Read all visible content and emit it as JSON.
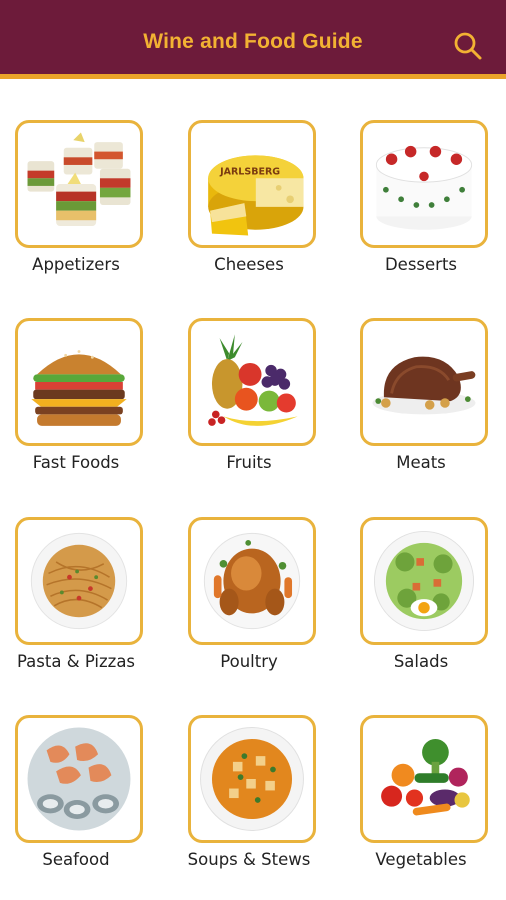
{
  "app": {
    "title": "Wine and Food Guide",
    "bar_color": "#6d1b3a",
    "accent_color": "#e9a42a",
    "search_icon": "search-icon"
  },
  "categories": [
    {
      "label": "Appetizers",
      "icon": "appetizers-image"
    },
    {
      "label": "Cheeses",
      "icon": "cheese-image"
    },
    {
      "label": "Desserts",
      "icon": "cake-image"
    },
    {
      "label": "Fast Foods",
      "icon": "burger-image"
    },
    {
      "label": "Fruits",
      "icon": "fruits-image"
    },
    {
      "label": "Meats",
      "icon": "roast-image"
    },
    {
      "label": "Pasta & Pizzas",
      "icon": "pasta-image"
    },
    {
      "label": "Poultry",
      "icon": "chicken-image"
    },
    {
      "label": "Salads",
      "icon": "salad-image"
    },
    {
      "label": "Seafood",
      "icon": "seafood-image"
    },
    {
      "label": "Soups & Stews",
      "icon": "soup-image"
    },
    {
      "label": "Vegetables",
      "icon": "vegetables-image"
    }
  ],
  "cheese_logo": "JARLSBERG"
}
